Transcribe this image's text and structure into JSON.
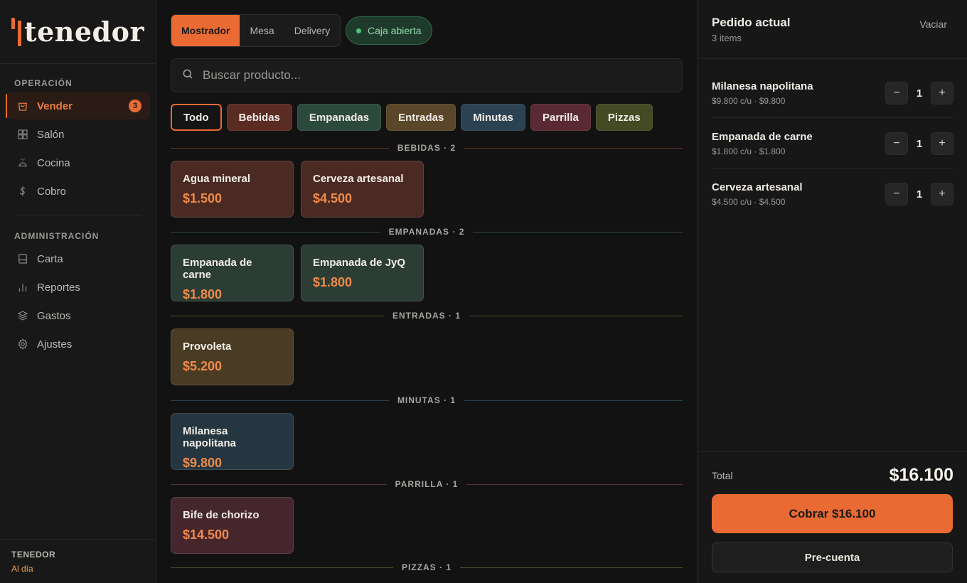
{
  "app": {
    "brand_name": "tenedor",
    "accent": "#ea6a33"
  },
  "sidebar": {
    "section_operacion": "OPERACIÓN",
    "section_admin": "ADMINISTRACIÓN",
    "items": [
      {
        "label": "Vender",
        "icon": "shopping-bag-icon",
        "badge": "3",
        "active": true
      },
      {
        "label": "Salón",
        "icon": "grid-icon"
      },
      {
        "label": "Cocina",
        "icon": "cooking-pot-icon"
      },
      {
        "label": "Cobro",
        "icon": "dollar-icon"
      },
      {
        "label": "Carta",
        "icon": "book-icon"
      },
      {
        "label": "Reportes",
        "icon": "bar-chart-icon"
      },
      {
        "label": "Gastos",
        "icon": "layers-icon"
      },
      {
        "label": "Ajustes",
        "icon": "gear-icon"
      }
    ],
    "footer": {
      "brand": "TENEDOR",
      "status": "Al día"
    }
  },
  "toolbar": {
    "modes": [
      "Mostrador",
      "Mesa",
      "Delivery"
    ],
    "active_mode": "Mostrador",
    "cash_status": "Caja abierta"
  },
  "search": {
    "placeholder": "Buscar producto..."
  },
  "filters": [
    {
      "label": "Todo",
      "color": "#141414"
    },
    {
      "label": "Bebidas",
      "color": "#5a2c22"
    },
    {
      "label": "Empanadas",
      "color": "#2c4a3c"
    },
    {
      "label": "Entradas",
      "color": "#5a4628"
    },
    {
      "label": "Minutas",
      "color": "#2a4252"
    },
    {
      "label": "Parrilla",
      "color": "#5a2a34"
    },
    {
      "label": "Pizzas",
      "color": "#434a24"
    }
  ],
  "categories": [
    {
      "label": "BEBIDAS",
      "count": "· 2",
      "line_color": "#5a3228",
      "card_color": "#4a2a22",
      "products": [
        {
          "name": "Agua mineral",
          "price": "$1.500"
        },
        {
          "name": "Cerveza artesanal",
          "price": "$4.500"
        }
      ]
    },
    {
      "label": "EMPANADAS",
      "count": "· 2",
      "line_color": "#2e4a3e",
      "card_color": "#2b3d34",
      "products": [
        {
          "name": "Empanada de carne",
          "price": "$1.800"
        },
        {
          "name": "Empanada de JyQ",
          "price": "$1.800"
        }
      ]
    },
    {
      "label": "ENTRADAS",
      "count": "· 1",
      "line_color": "#5a4a2c",
      "card_color": "#4a3c24",
      "products": [
        {
          "name": "Provoleta",
          "price": "$5.200"
        }
      ]
    },
    {
      "label": "MINUTAS",
      "count": "· 1",
      "line_color": "#2c4250",
      "card_color": "#253640",
      "products": [
        {
          "name": "Milanesa napolitana",
          "price": "$9.800"
        }
      ]
    },
    {
      "label": "PARRILLA",
      "count": "· 1",
      "line_color": "#56303a",
      "card_color": "#46262d",
      "products": [
        {
          "name": "Bife de chorizo",
          "price": "$14.500"
        }
      ]
    },
    {
      "label": "PIZZAS",
      "count": "· 1",
      "line_color": "#46502a",
      "card_color": "#3a4020",
      "products": []
    }
  ],
  "order": {
    "title": "Pedido actual",
    "count": "3 items",
    "clear_label": "Vaciar",
    "items": [
      {
        "name": "Milanesa napolitana",
        "detail": "$9.800 c/u · $9.800",
        "qty": "1"
      },
      {
        "name": "Empanada de carne",
        "detail": "$1.800 c/u · $1.800",
        "qty": "1"
      },
      {
        "name": "Cerveza artesanal",
        "detail": "$4.500 c/u · $4.500",
        "qty": "1"
      }
    ],
    "minus": "−",
    "plus": "+",
    "total_label": "Total",
    "total_value": "$16.100",
    "pay_label": "Cobrar $16.100",
    "precheck_label": "Pre-cuenta"
  }
}
